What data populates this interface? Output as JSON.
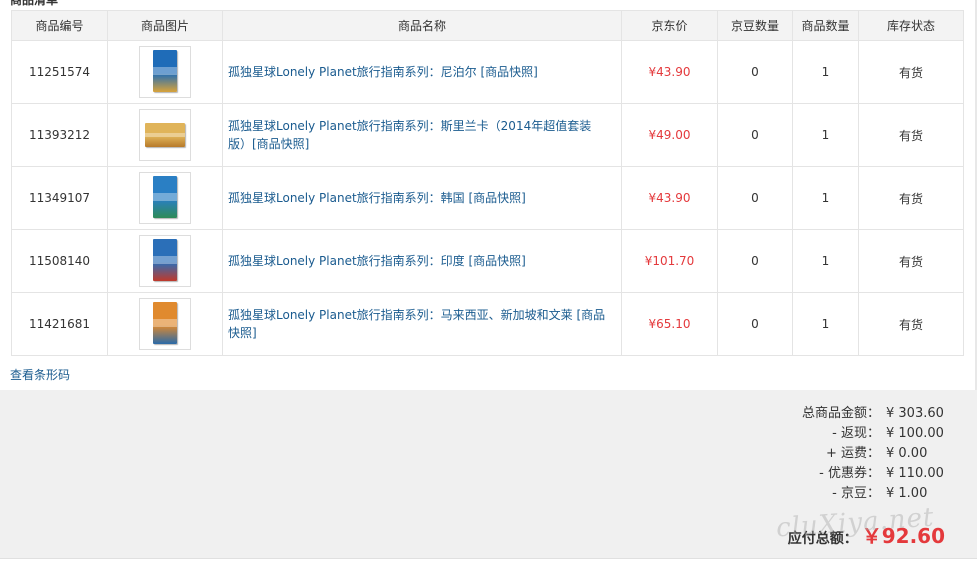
{
  "section_title": "商品清单",
  "columns": [
    "商品编号",
    "商品图片",
    "商品名称",
    "京东价",
    "京豆数量",
    "商品数量",
    "库存状态"
  ],
  "rows": [
    {
      "id": "11251574",
      "name": "孤独星球Lonely Planet旅行指南系列：尼泊尔 [商品快照]",
      "price": "¥43.90",
      "beans": "0",
      "qty": "1",
      "stock": "有货",
      "cover": [
        "#1f6cb8",
        "#d8a33a"
      ],
      "wide": false
    },
    {
      "id": "11393212",
      "name": "孤独星球Lonely Planet旅行指南系列：斯里兰卡（2014年超值套装版）[商品快照]",
      "price": "¥49.00",
      "beans": "0",
      "qty": "1",
      "stock": "有货",
      "cover": [
        "#e0b45a",
        "#b77a2a"
      ],
      "wide": true
    },
    {
      "id": "11349107",
      "name": "孤独星球Lonely Planet旅行指南系列：韩国 [商品快照]",
      "price": "¥43.90",
      "beans": "0",
      "qty": "1",
      "stock": "有货",
      "cover": [
        "#2a7fc4",
        "#2e8b57"
      ],
      "wide": false
    },
    {
      "id": "11508140",
      "name": "孤独星球Lonely Planet旅行指南系列：印度 [商品快照]",
      "price": "¥101.70",
      "beans": "0",
      "qty": "1",
      "stock": "有货",
      "cover": [
        "#2b6fb8",
        "#c0392b"
      ],
      "wide": false
    },
    {
      "id": "11421681",
      "name": "孤独星球Lonely Planet旅行指南系列：马来西亚、新加坡和文莱 [商品快照]",
      "price": "¥65.10",
      "beans": "0",
      "qty": "1",
      "stock": "有货",
      "cover": [
        "#e08a2e",
        "#2a6aa8"
      ],
      "wide": false
    }
  ],
  "barcode_link": "查看条形码",
  "summary": [
    {
      "label": "总商品金额：",
      "value": "¥ 303.60"
    },
    {
      "label": "- 返现：",
      "value": "¥ 100.00"
    },
    {
      "label": "+ 运费：",
      "value": "¥ 0.00"
    },
    {
      "label": "- 优惠券：",
      "value": "¥ 110.00"
    },
    {
      "label": "- 京豆：",
      "value": "¥ 1.00"
    }
  ],
  "total": {
    "label": "应付总额：",
    "value": "￥92.60"
  },
  "watermark": "cluXiya.net"
}
